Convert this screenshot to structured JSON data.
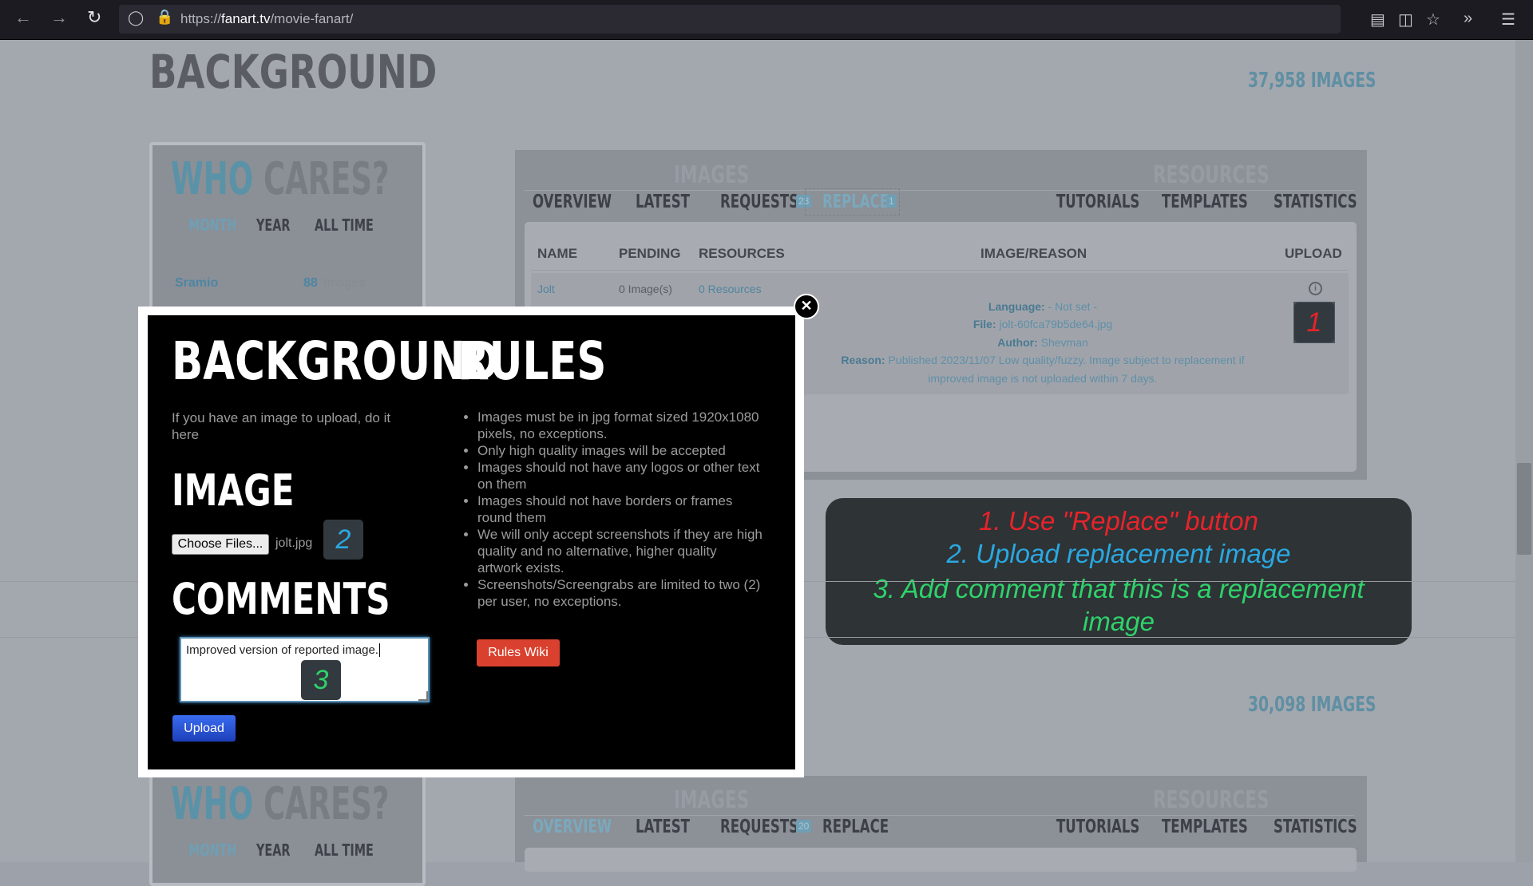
{
  "browser": {
    "url_prefix": "https://",
    "url_host": "fanart.tv",
    "url_path": "/movie-fanart/"
  },
  "section1": {
    "title": "BACKGROUND",
    "count_num": "37,958",
    "count_label": "IMAGES"
  },
  "section2": {
    "count_num": "30,098",
    "count_label": "IMAGES"
  },
  "sidebar": {
    "who": "WHO",
    "cares": "CARES?",
    "tabs": [
      "MONTH",
      "YEAR",
      "ALL TIME"
    ],
    "row1_name": "Sramio",
    "row1_count": "88",
    "row1_unit": "Images"
  },
  "panel": {
    "images_label": "IMAGES",
    "resources_label": "RESOURCES",
    "tabs_top": [
      "OVERVIEW",
      "LATEST",
      "REQUESTS",
      "REPLACE",
      "TUTORIALS",
      "TEMPLATES",
      "STATISTICS"
    ],
    "requests_badge_top": "23",
    "replace_badge_top": "1",
    "requests_badge_bottom": "20"
  },
  "table": {
    "headers": [
      "NAME",
      "PENDING",
      "RESOURCES",
      "IMAGE/REASON",
      "UPLOAD"
    ],
    "row": {
      "name": "Jolt",
      "pending": "0 Image(s)",
      "resources": "0 Resources",
      "language_label": "Language:",
      "language_value": "- Not set -",
      "file_label": "File:",
      "file_value": "jolt-60fca79b5de64.jpg",
      "author_label": "Author:",
      "author_value": "Shevman",
      "reason_label": "Reason:",
      "reason_value_1": "Published 2023/11/07 Low quality/fuzzy. Image subject to replacement if",
      "reason_value_2": "improved image is not uploaded within 7 days."
    }
  },
  "callout": {
    "line1": "1. Use \"Replace\" button",
    "line2": "2. Upload replacement  image",
    "line3": "3. Add comment that this is a replacement",
    "line4": "image",
    "colors": {
      "step1": "#e8232a",
      "step2": "#2aa8e0",
      "step3": "#2ed36a"
    }
  },
  "markers": {
    "m1": "1",
    "m2": "2",
    "m3": "3"
  },
  "modal": {
    "title_left": "BACKGROUND",
    "title_right": "RULES",
    "intro": "If you have an image to upload, do it here",
    "image_heading": "IMAGE",
    "choose_label": "Choose Files...",
    "file_name": "jolt.jpg",
    "comments_heading": "COMMENTS",
    "comment_value": "Improved version of reported image.",
    "upload_label": "Upload",
    "rules": [
      "Images must be in jpg format sized 1920x1080 pixels, no exceptions.",
      "Only high quality images will be accepted",
      "Images should not have any logos or other text on them",
      "Images should not have borders or frames round them",
      "We will only accept screenshots if they are high quality and no alternative, higher quality artwork exists.",
      "Screenshots/Screengrabs are limited to two (2) per user, no exceptions."
    ],
    "rules_wiki_label": "Rules Wiki"
  }
}
